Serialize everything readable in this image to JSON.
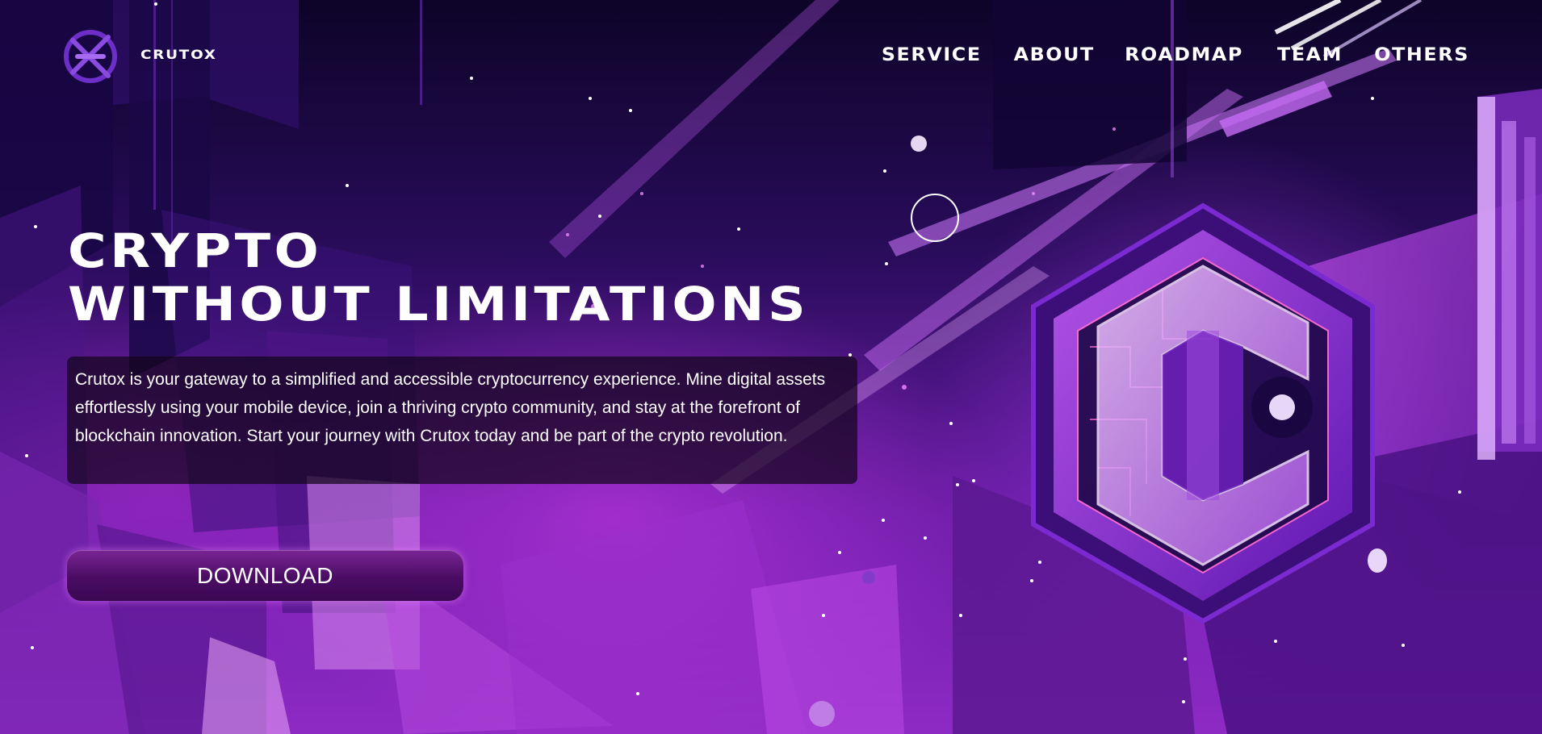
{
  "header": {
    "brand": "CRUTOX",
    "nav": [
      "SERVICE",
      "ABOUT",
      "ROADMAP",
      "TEAM",
      "OTHERS"
    ]
  },
  "hero": {
    "title_line1": "CRYPTO",
    "title_line2": "WITHOUT LIMITATIONS",
    "description": "Crutox is your gateway to a simplified and accessible cryptocurrency experience. Mine digital assets effortlessly using your mobile device, join a thriving crypto community, and stay at the forefront of blockchain innovation. Start your journey with Crutox today and be part of the crypto revolution.",
    "download_label": "DOWNLOAD"
  },
  "icons": {
    "logo": "crutox-logo-icon",
    "emblem": "crutox-c-emblem"
  },
  "colors": {
    "accent": "#9b3de0",
    "button": "#5a1475",
    "text": "#ffffff"
  }
}
